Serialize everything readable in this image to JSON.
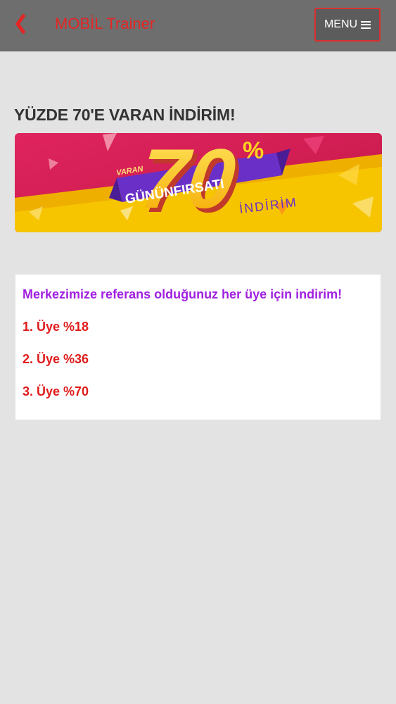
{
  "header": {
    "app_title": "MOBİL Trainer",
    "menu_label": "MENU",
    "back_icon": "chevron-left-icon",
    "menu_icon": "hamburger-icon"
  },
  "page": {
    "heading": "YÜZDE 70'E VARAN İNDİRİM!"
  },
  "banner": {
    "prefix": "VARAN",
    "number": "70",
    "percent": "%",
    "ribbon": "GÜNÜNFIRSATI",
    "suffix": "İNDİRİM"
  },
  "card": {
    "title": "Merkezimize referans olduğunuz her üye için indirim!",
    "items": [
      "1. Üye %18",
      "2. Üye %36",
      "3. Üye %70"
    ]
  },
  "colors": {
    "accent_red": "#e52525",
    "purple": "#a020e0",
    "topbar": "#6e6e6e",
    "background": "#e3e3e3"
  }
}
